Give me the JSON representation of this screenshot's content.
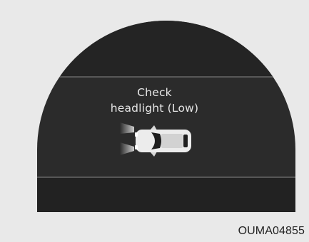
{
  "display": {
    "message_line1": "Check",
    "message_line2": "headlight (Low)",
    "icon": "vehicle-headlight-icon"
  },
  "figure_code": "OUMA04855",
  "colors": {
    "background": "#e9e9e9",
    "display_dark": "#232323",
    "display_band": "#2e2e2e",
    "divider": "#8a8a8a",
    "text": "#e6e6e6"
  }
}
